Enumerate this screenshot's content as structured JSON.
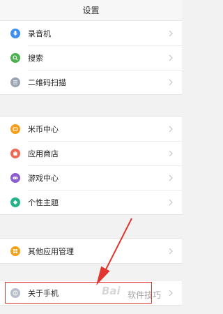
{
  "header": {
    "title": "设置"
  },
  "groups": [
    {
      "items": [
        {
          "label": "录音机",
          "icon": "microphone-icon",
          "color": "#3d8ff2"
        },
        {
          "label": "搜索",
          "icon": "search-icon",
          "color": "#4cb04f"
        },
        {
          "label": "二维码扫描",
          "icon": "qr-scan-icon",
          "color": "#9aa4b3"
        }
      ]
    },
    {
      "items": [
        {
          "label": "米币中心",
          "icon": "coin-icon",
          "color": "#f5a01d"
        },
        {
          "label": "应用商店",
          "icon": "store-icon",
          "color": "#ef6a55"
        },
        {
          "label": "游戏中心",
          "icon": "gamepad-icon",
          "color": "#8a5bd1"
        },
        {
          "label": "个性主题",
          "icon": "theme-icon",
          "color": "#22b38b"
        }
      ]
    },
    {
      "items": [
        {
          "label": "其他应用管理",
          "icon": "apps-icon",
          "color": "#f5a01d"
        }
      ]
    },
    {
      "items": [
        {
          "label": "关于手机",
          "icon": "info-icon",
          "color": "#b7bec9"
        }
      ]
    }
  ],
  "watermark": {
    "logo": "Bai",
    "text": "软件技巧"
  },
  "annotation_color": "#e0362f"
}
